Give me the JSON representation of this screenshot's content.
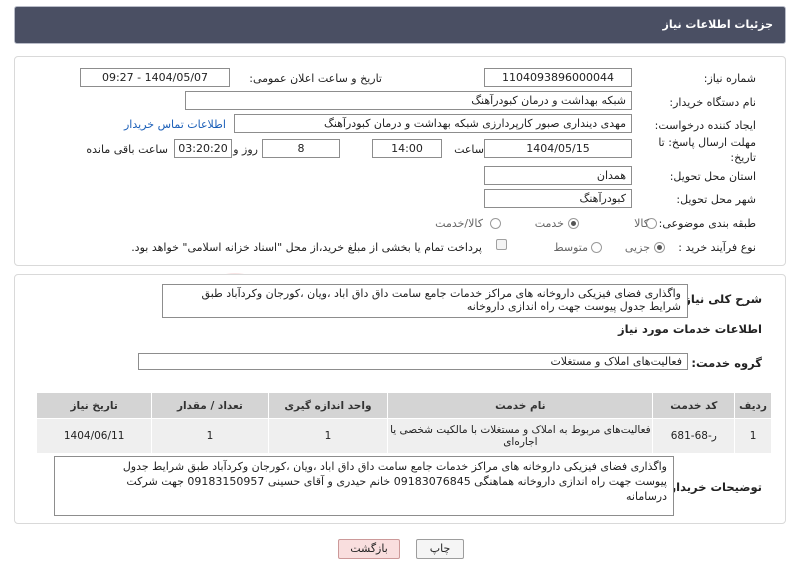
{
  "header": {
    "title": "جزئیات اطلاعات نیاز"
  },
  "form": {
    "need_number_label": "شماره نیاز:",
    "need_number": "1104093896000044",
    "announce_label": "تاریخ و ساعت اعلان عمومی:",
    "announce_value": "1404/05/07 - 09:27",
    "buyer_org_label": "نام دستگاه خریدار:",
    "buyer_org": "شبکه بهداشت و درمان کبودرآهنگ",
    "creator_label": "ایجاد کننده درخواست:",
    "creator": "مهدی دینداری صبور کارپردارزی شبکه بهداشت و درمان کبودرآهنگ",
    "contact_link": "اطلاعات تماس خریدار",
    "deadline_label_1": "مهلت ارسال پاسخ: تا",
    "deadline_label_2": "تاریخ:",
    "deadline_date": "1404/05/15",
    "time_label": "ساعت",
    "deadline_time": "14:00",
    "days_value": "8",
    "days_label": "روز و",
    "remaining_time": "03:20:20",
    "remaining_label": "ساعت باقی مانده",
    "province_label": "استان محل تحویل:",
    "province": "همدان",
    "city_label": "شهر محل تحویل:",
    "city": "کبودرآهنگ",
    "category_label": "طبقه بندی موضوعی:",
    "category_options": [
      "کالا",
      "خدمت",
      "کالا/خدمت"
    ],
    "category_selected": 1,
    "process_label": "نوع فرآیند خرید :",
    "process_options": [
      "جزیی",
      "متوسط"
    ],
    "process_selected": 0,
    "payment_text": "پرداخت تمام یا بخشی از مبلغ خرید،از محل \"اسناد خزانه اسلامی\" خواهد بود."
  },
  "details": {
    "summary_label": "شرح کلی نیاز:",
    "summary_line1": "واگذاری فضای فیزیکی داروخانه های مراکز خدمات جامع سامت داق داق اباد ،ویان ،کورجان وکردآباد طبق",
    "summary_line2": "شرایط جدول پیوست جهت راه اندازی داروخانه",
    "services_heading": "اطلاعات خدمات مورد نیاز",
    "service_group_label": "گروه خدمت:",
    "service_group": "فعالیت‌های  املاک و مستغلات",
    "table": {
      "headers": [
        "ردیف",
        "کد خدمت",
        "نام خدمت",
        "واحد اندازه گیری",
        "تعداد / مقدار",
        "تاریخ نیاز"
      ],
      "rows": [
        {
          "row": "1",
          "code": "ر-68-681",
          "name_line1": "فعالیت‌های مربوط به املاک و مستغلات با مالکیت شخصی یا",
          "name_line2": "اجاره‌ای",
          "unit": "1",
          "qty": "1",
          "date": "1404/06/11"
        }
      ]
    },
    "buyer_notes_label": "توضیحات خریدار:",
    "buyer_notes_line1": "واگذاری فضای فیزیکی داروخانه های مراکز خدمات جامع سامت داق داق اباد ،ویان ،کورجان وکردآباد طبق شرایط جدول",
    "buyer_notes_line2": "پیوست جهت راه اندازی داروخانه هماهنگی 09183076845  خانم حیدری و آقای حسینی 09183150957 جهت شرکت",
    "buyer_notes_line3": "درسامانه"
  },
  "buttons": {
    "print": "چاپ",
    "back": "بازگشت"
  },
  "watermark": {
    "text": "AriaTender.net"
  },
  "colors": {
    "header_bg": "#4a4f63",
    "link": "#1b5fb8",
    "back_button": "#f9dede",
    "watermark": "#e9b4b4"
  }
}
